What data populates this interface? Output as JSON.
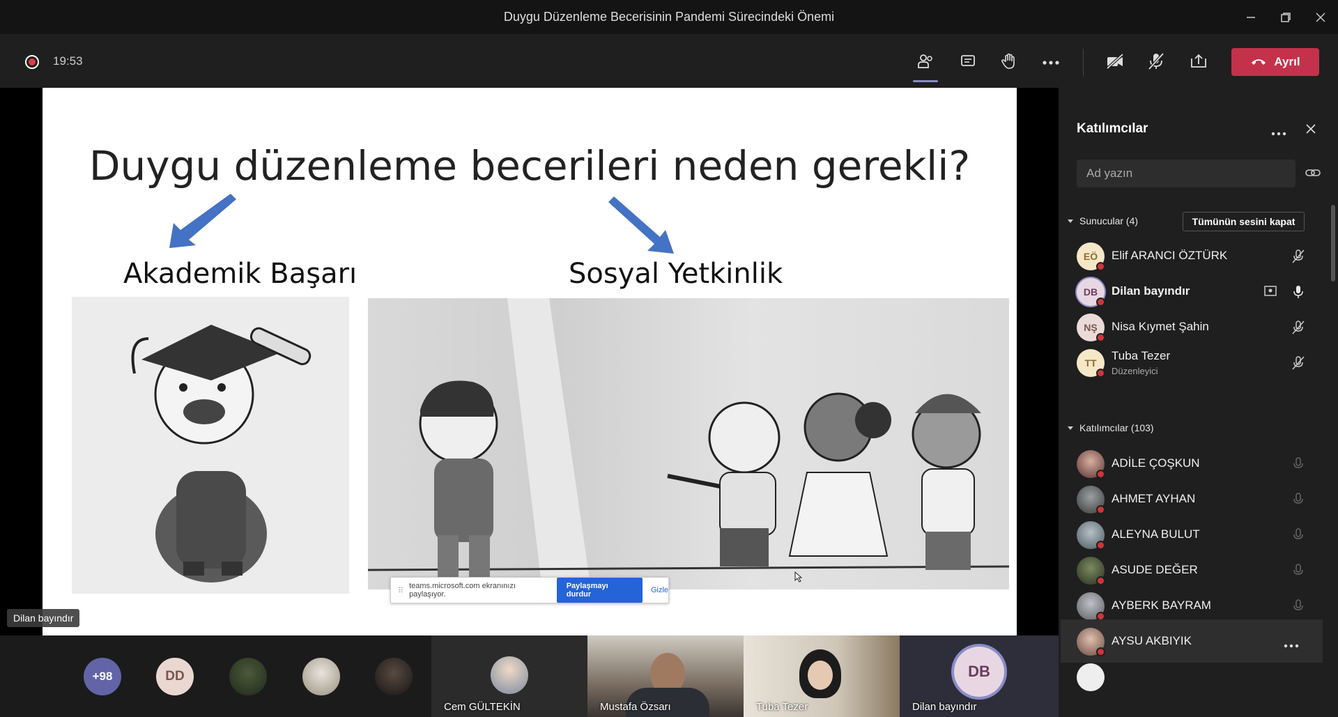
{
  "window": {
    "title": "Duygu Düzenleme Becerisinin Pandemi Sürecindeki Önemi"
  },
  "toolbar": {
    "timer": "19:53",
    "leave_label": "Ayrıl"
  },
  "slide": {
    "title": "Duygu düzenleme becerileri neden gerekli?",
    "left_label": "Akademik Başarı",
    "right_label": "Sosyal Yetkinlik"
  },
  "sharebar": {
    "text": "teams.microsoft.com ekranınızı paylaşıyor.",
    "stop_label": "Paylaşmayı durdur",
    "hide_label": "Gizle"
  },
  "stage": {
    "presenter_badge": "Dilan bayındır"
  },
  "bottom": {
    "overflow_count": "+98",
    "dd_initials": "DD",
    "tiles": [
      {
        "name": "Cem GÜLTEKİN"
      },
      {
        "name": "Mustafa Özsarı"
      },
      {
        "name": "Tuba Tezer"
      },
      {
        "name": "Dilan bayındır",
        "initials": "DB"
      }
    ]
  },
  "panel": {
    "title": "Katılımcılar",
    "search_placeholder": "Ad yazın",
    "presenters_label": "Sunucular (4)",
    "mute_all_label": "Tümünün sesini kapat",
    "attendees_label": "Katılımcılar (103)",
    "presenters": [
      {
        "initials": "EÖ",
        "name": "Elif ARANCI ÖZTÜRK",
        "role": "",
        "color": "#f6e7c8",
        "text_color": "#8a6d2c"
      },
      {
        "initials": "DB",
        "name": "Dilan bayındır",
        "role": "",
        "color": "#e8d7e3",
        "text_color": "#6b3d5e"
      },
      {
        "initials": "NŞ",
        "name": "Nisa Kıymet Şahin",
        "role": "",
        "color": "#eadbd8",
        "text_color": "#7a5550"
      },
      {
        "initials": "TT",
        "name": "Tuba Tezer",
        "role": "Düzenleyici",
        "color": "#f6e7c8",
        "text_color": "#8a6d2c"
      }
    ],
    "attendees": [
      {
        "name": "ADİLE ÇOŞKUN"
      },
      {
        "name": "AHMET AYHAN"
      },
      {
        "name": "ALEYNA BULUT"
      },
      {
        "name": "ASUDE DEĞER"
      },
      {
        "name": "AYBERK BAYRAM"
      },
      {
        "name": "AYSU AKBIYIK"
      }
    ]
  },
  "colors": {
    "leave": "#c4314b",
    "accent": "#8b8cc7",
    "stop_share": "#2563d8",
    "arrow": "#4472c4"
  }
}
